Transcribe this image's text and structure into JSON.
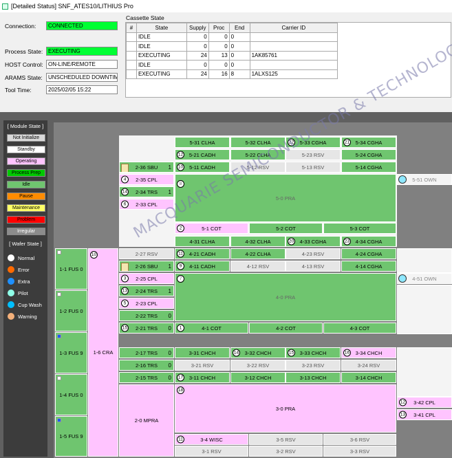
{
  "window": {
    "title": "[Detailed Status] SNF_ATES10/LITHIUS Pro"
  },
  "status": {
    "connection_label": "Connection:",
    "connection_value": "CONNECTED",
    "process_state_label": "Process State:",
    "process_state_value": "EXECUTING",
    "host_control_label": "HOST Control:",
    "host_control_value": "ON-LINE/REMOTE",
    "arams_state_label": "ARAMS State:",
    "arams_state_value": "UNSCHEDULED DOWNTIME",
    "tool_time_label": "Tool Time:",
    "tool_time_value": "2025/02/05 15:22"
  },
  "cassette": {
    "title": "Cassette State",
    "headers": [
      "#",
      "State",
      "Supply",
      "Proc",
      "End",
      "Carrier ID"
    ],
    "rows": [
      [
        "",
        "IDLE",
        "0",
        "0",
        "0",
        ""
      ],
      [
        "",
        "IDLE",
        "0",
        "0",
        "0",
        ""
      ],
      [
        "",
        "EXECUTING",
        "24",
        "13",
        "0",
        "1AK85761"
      ],
      [
        "",
        "IDLE",
        "0",
        "0",
        "0",
        ""
      ],
      [
        "",
        "EXECUTING",
        "24",
        "16",
        "8",
        "1ALXS125"
      ]
    ]
  },
  "legend": {
    "module_header": "[ Module State ]",
    "module_states": [
      {
        "label": "Not Initialize",
        "color": "#d8d8d8"
      },
      {
        "label": "Standby",
        "color": "#ffffff"
      },
      {
        "label": "Operating",
        "color": "#ffc4ff"
      },
      {
        "label": "Process Prep",
        "color": "#00c800"
      },
      {
        "label": "Idle",
        "color": "#6fc56f"
      },
      {
        "label": "Pause",
        "color": "#ff8c00"
      },
      {
        "label": "Maintenance",
        "color": "#ffff66"
      },
      {
        "label": "Problem",
        "color": "#ff0000"
      },
      {
        "label": "Irregular",
        "color": "#8c8c8c"
      }
    ],
    "wafer_header": "[ Wafer State ]",
    "wafer_states": [
      {
        "label": "Normal",
        "color": "#ffffff"
      },
      {
        "label": "Error",
        "color": "#ff6a00"
      },
      {
        "label": "Extra",
        "color": "#1e90ff"
      },
      {
        "label": "Pilot",
        "color": "#90ffe8"
      },
      {
        "label": "Cup Wash",
        "color": "#00bfff"
      },
      {
        "label": "Warning",
        "color": "#f4b07a"
      }
    ]
  },
  "modules": {
    "m531": "5-31 CLHA",
    "m532": "5-32 CLHA",
    "m533": "5-33 CGHA",
    "m534": "5-34 CGHA",
    "m521": "5-21 CADH",
    "m522": "5-22 CLHA",
    "m523": "5-23 RSV",
    "m524": "5-24 CGHA",
    "m536": "2-36 SBU",
    "m536n": "1",
    "m511": "5-11 CADH",
    "m512": "5-12 RSV",
    "m513": "5-13 RSV",
    "m514": "5-14 CGHA",
    "m235": "2-35 CPL",
    "m234": "2-34 TRS",
    "m234n": "1",
    "m233": "2-33 CPL",
    "m50": "5-0 PRA",
    "m551": "5-51 OWN",
    "m51": "5-1 COT",
    "m52": "5-2 COT",
    "m53": "5-3 COT",
    "m431": "4-31 CLHA",
    "m432": "4-32 CLHA",
    "m433": "4-33 CGHA",
    "m434": "4-34 CGHA",
    "m227": "2-27 RSV",
    "m421": "4-21 CADH",
    "m422": "4-22 CLHA",
    "m423": "4-23 RSV",
    "m424": "4-24 CGHA",
    "m226": "2-26 SBU",
    "m226n": "1",
    "m411": "4-11 CADH",
    "m412": "4-12 RSV",
    "m413": "4-13 RSV",
    "m414": "4-14 CGHA",
    "m225": "2-25 CPL",
    "m224": "2-24 TRS",
    "m224n": "1",
    "m223": "2-23 CPL",
    "m222": "2-22 TRS",
    "m222n": "0",
    "m221": "2-21 TRS",
    "m221n": "0",
    "m40": "4-0 PRA",
    "m451": "4-51 OWN",
    "m41": "4-1 COT",
    "m42": "4-2 COT",
    "m43": "4-3 COT",
    "m11": "1-1 FUS",
    "m11n": "0",
    "m12": "1-2 FUS",
    "m12n": "0",
    "m13": "1-3 FUS",
    "m13n": "9",
    "m14": "1-4 FUS",
    "m14n": "0",
    "m15": "1-5 FUS",
    "m15n": "9",
    "m16": "1-6 CRA",
    "m217": "2-17 TRS",
    "m217n": "0",
    "m216": "2-16 TRS",
    "m216n": "0",
    "m215": "2-15 TRS",
    "m215n": "0",
    "m331": "3-31 CHCH",
    "m332": "3-32 CHCH",
    "m333": "3-33 CHCH",
    "m334": "3-34 CHCH",
    "m321": "3-21 RSV",
    "m322": "3-22 RSV",
    "m323": "3-23 RSV",
    "m324": "3-24 RSV",
    "m311": "3-11 CHCH",
    "m312": "3-12 CHCH",
    "m313": "3-13 CHCH",
    "m314": "3-14 CHCH",
    "m20": "2-0 MPRA",
    "m30": "3-0 PRA",
    "m342": "3-42 CPL",
    "m341": "3-41 CPL",
    "m34": "3-4 WISC",
    "m35": "3-5 RSV",
    "m36": "3-6 RSV",
    "m31": "3-1 RSV",
    "m32": "3-2 RSV",
    "m33": "3-3 RSV"
  },
  "watermark": "MACQUARIE SEMICONDUCTOR & TECHNOLOGY"
}
